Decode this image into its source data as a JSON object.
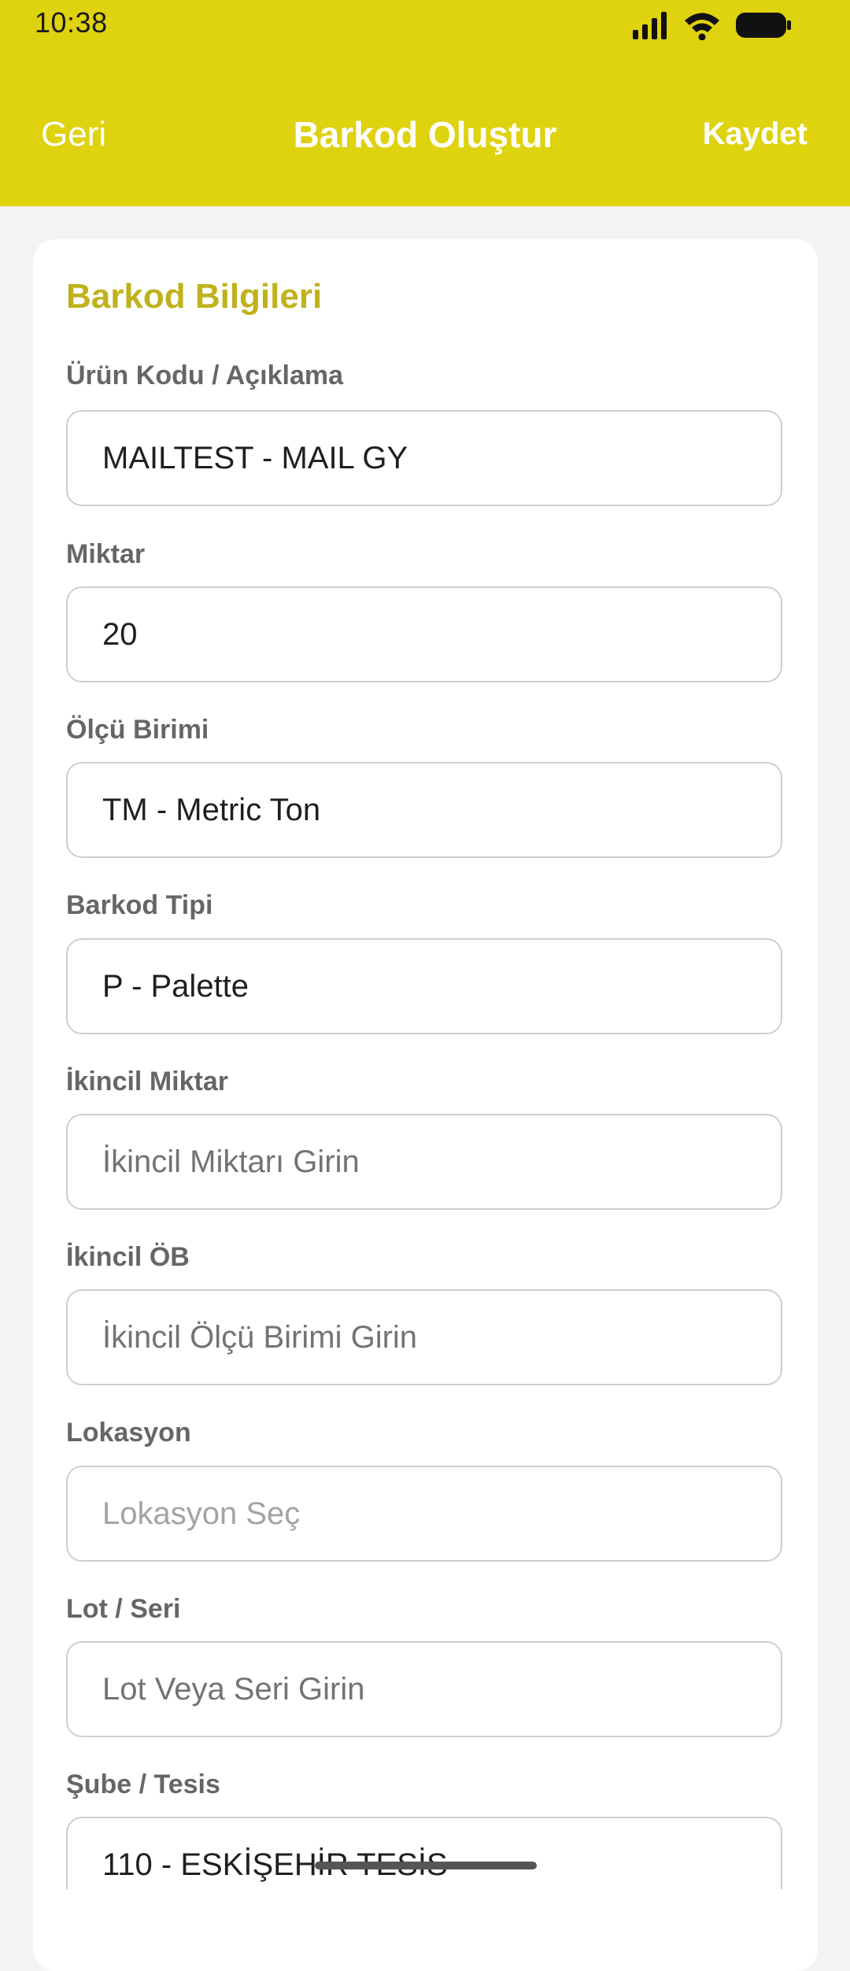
{
  "status_bar": {
    "time": "10:38",
    "icons": [
      "signal-icon",
      "wifi-icon",
      "battery-icon"
    ]
  },
  "header": {
    "back_label": "Geri",
    "title": "Barkod Oluştur",
    "save_label": "Kaydet"
  },
  "form": {
    "section_title": "Barkod Bilgileri",
    "fields": [
      {
        "label": "Ürün Kodu / Açıklama",
        "value": "MAILTEST - MAIL GY",
        "placeholder": ""
      },
      {
        "label": "Miktar",
        "value": "20",
        "placeholder": ""
      },
      {
        "label": "Ölçü Birimi",
        "value": "TM - Metric Ton",
        "placeholder": ""
      },
      {
        "label": "Barkod Tipi",
        "value": "P - Palette",
        "placeholder": ""
      },
      {
        "label": "İkincil Miktar",
        "value": "",
        "placeholder": "İkincil Miktarı Girin"
      },
      {
        "label": "İkincil ÖB",
        "value": "",
        "placeholder": "İkincil Ölçü Birimi Girin"
      },
      {
        "label": "Lokasyon",
        "value": "",
        "placeholder": "Lokasyon Seç"
      },
      {
        "label": "Lot / Seri",
        "value": "",
        "placeholder": "Lot Veya Seri Girin"
      },
      {
        "label": "Şube / Tesis",
        "value": "110 - ESKİŞEHİR TESİS",
        "placeholder": ""
      }
    ]
  },
  "colors": {
    "header_bg": "#dfd20f",
    "accent": "#bfb21c"
  }
}
